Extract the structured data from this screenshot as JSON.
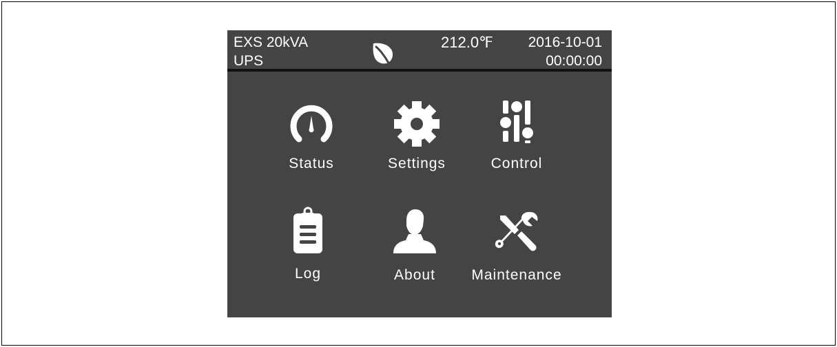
{
  "device": {
    "model_line1": "EXS 20kVA",
    "model_line2": "UPS",
    "mode_icon": "leaf-icon",
    "temperature": "212.0℉",
    "date": "2016-10-01",
    "time": "00:00:00"
  },
  "menu": {
    "items": [
      {
        "label": "Status",
        "icon": "gauge-icon"
      },
      {
        "label": "Settings",
        "icon": "gear-icon"
      },
      {
        "label": "Control",
        "icon": "sliders-icon"
      },
      {
        "label": "Log",
        "icon": "clipboard-icon"
      },
      {
        "label": "About",
        "icon": "user-icon"
      },
      {
        "label": "Maintenance",
        "icon": "tools-icon"
      }
    ]
  },
  "colors": {
    "screen_bg": "#444444",
    "header_rule": "#111111",
    "foreground": "#ffffff"
  }
}
